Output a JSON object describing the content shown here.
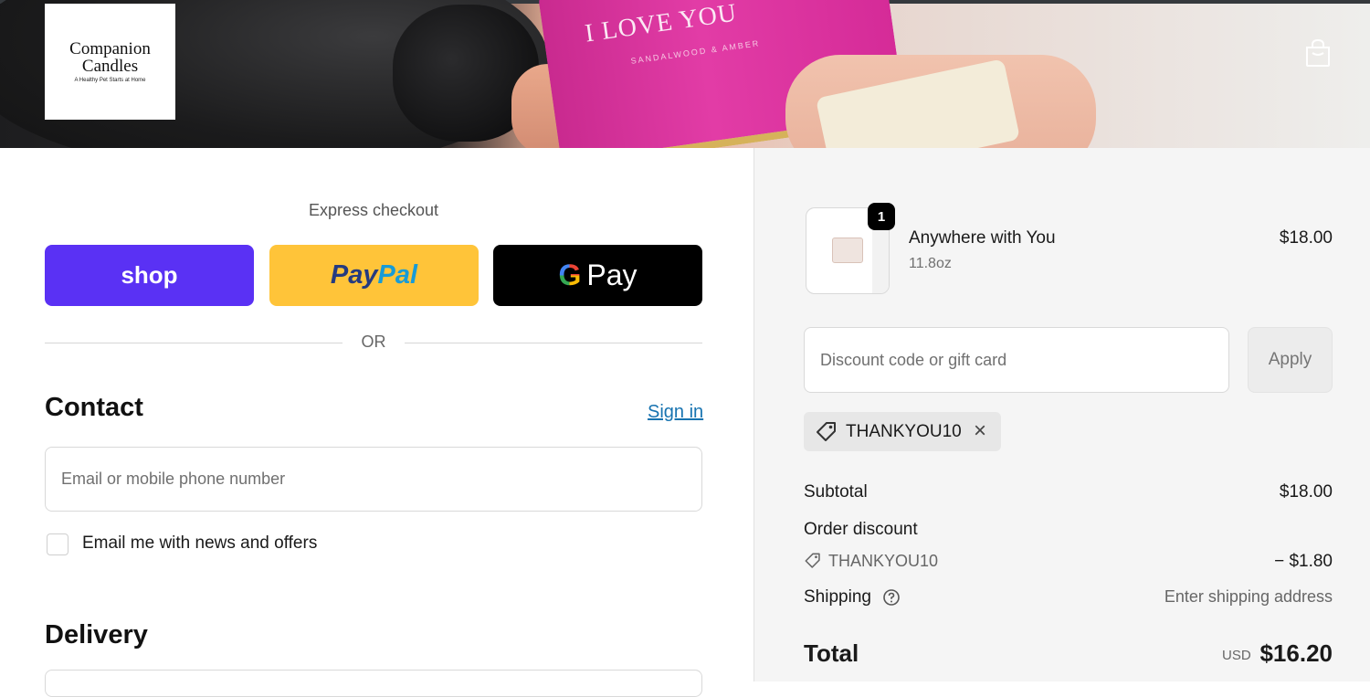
{
  "brand": {
    "logo_line1": "Companion",
    "logo_line2": "Candles",
    "logo_tagline": "A Healthy Pet Starts at Home",
    "candle_text": "I LOVE YOU",
    "candle_subtext": "SANDALWOOD & AMBER",
    "cart_icon": "shopping-bag-icon"
  },
  "express": {
    "label": "Express checkout",
    "shop_label": "shop",
    "paypal_part1": "Pay",
    "paypal_part2": "Pal",
    "gpay_g": "G",
    "gpay_label": "Pay",
    "or_label": "OR"
  },
  "contact": {
    "heading": "Contact",
    "signin_label": "Sign in",
    "email_placeholder": "Email or mobile phone number",
    "email_value": "",
    "newsletter_label": "Email me with news and offers",
    "newsletter_checked": false
  },
  "delivery": {
    "heading": "Delivery"
  },
  "summary": {
    "item": {
      "quantity": "1",
      "name": "Anywhere with You",
      "variant": "11.8oz",
      "price": "$18.00"
    },
    "discount": {
      "placeholder": "Discount code or gift card",
      "value": "",
      "apply_label": "Apply",
      "applied_code": "THANKYOU10"
    },
    "subtotal_label": "Subtotal",
    "subtotal_value": "$18.00",
    "order_discount_label": "Order discount",
    "order_discount_code": "THANKYOU10",
    "order_discount_value": "− $1.80",
    "shipping_label": "Shipping",
    "shipping_value": "Enter shipping address",
    "total_label": "Total",
    "total_currency": "USD",
    "total_value": "$16.20"
  },
  "colors": {
    "shop": "#5a31f4",
    "paypal": "#ffc439",
    "gpay": "#000000",
    "link": "#1773b0",
    "summary_bg": "#f5f5f5"
  }
}
